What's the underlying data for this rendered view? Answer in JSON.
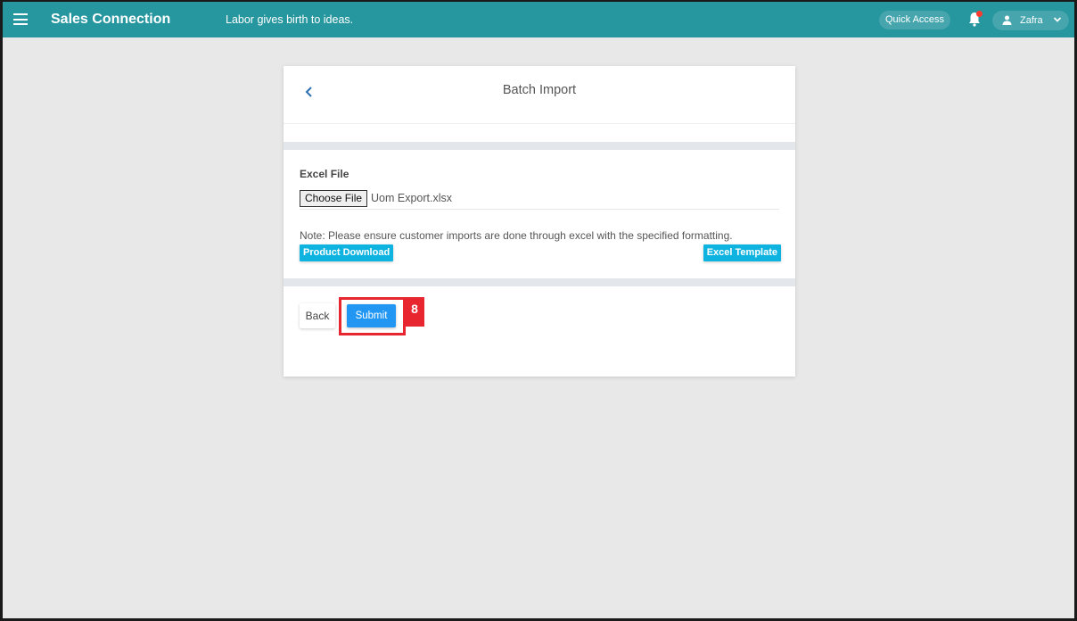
{
  "topbar": {
    "app_title": "Sales Connection",
    "tagline": "Labor gives birth to ideas.",
    "quick_access": "Quick Access",
    "user_name": "Zafra",
    "notification_dot_color": "#ff3b30",
    "brand_color": "#26969f"
  },
  "card": {
    "title": "Batch Import",
    "excel_file_label": "Excel File",
    "choose_file_label": "Choose File",
    "file_name": "Uom Export.xlsx",
    "note": "Note: Please ensure customer imports are done through excel with the specified formatting.",
    "product_download": "Product Download",
    "excel_template": "Excel Template",
    "back": "Back",
    "submit": "Submit"
  },
  "annotation": {
    "label": "8"
  }
}
